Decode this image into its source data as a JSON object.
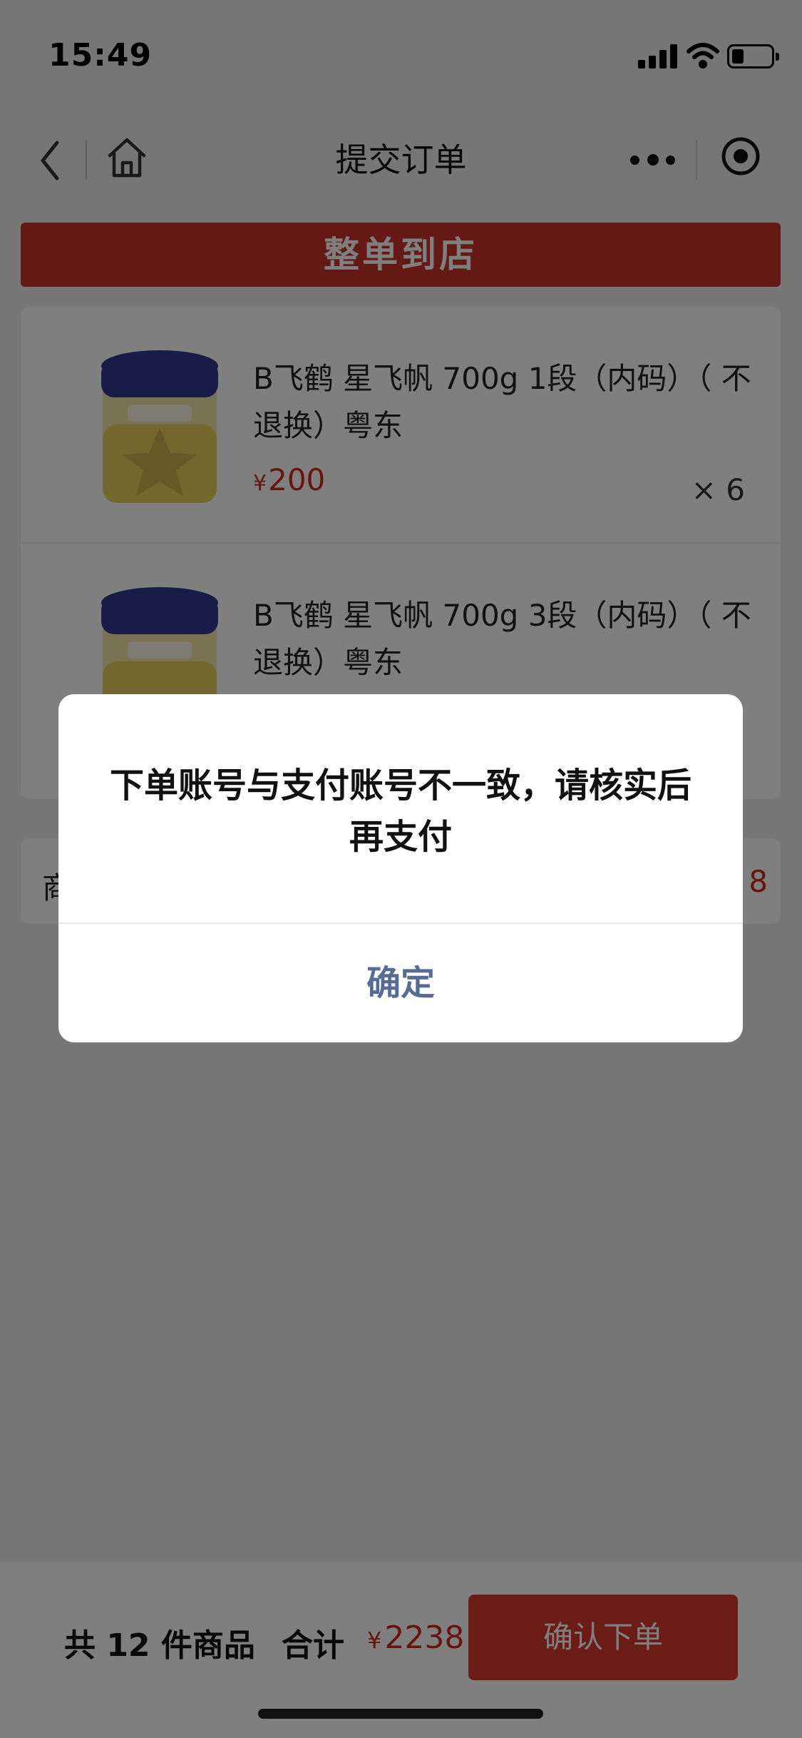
{
  "status_bar": {
    "time": "15:49"
  },
  "nav": {
    "title": "提交订单",
    "icons": [
      "back-icon",
      "home-icon",
      "more-icon",
      "target-icon"
    ]
  },
  "banner": {
    "label": "整单到店"
  },
  "products": [
    {
      "name": "B飞鹤 星飞帆 700g 1段（内码）（ 不退换）粤东",
      "price_symbol": "¥",
      "price": "200",
      "quantity": "× 6"
    },
    {
      "name": "B飞鹤 星飞帆 700g 3段（内码）（ 不退换）粤东"
    }
  ],
  "summary": {
    "label_visible": "商",
    "value_visible": "8"
  },
  "bottom_bar": {
    "count_text": "共 12 件商品",
    "total_label": "合计",
    "total_symbol": "¥",
    "total_amount": "2238",
    "confirm_label": "确认下单"
  },
  "dialog": {
    "message": "下单账号与支付账号不一致，请核实后再支付",
    "confirm_label": "确定"
  },
  "colors": {
    "accent": "#d02a20",
    "banner": "#c8332b",
    "dialog_button": "#576b95"
  }
}
